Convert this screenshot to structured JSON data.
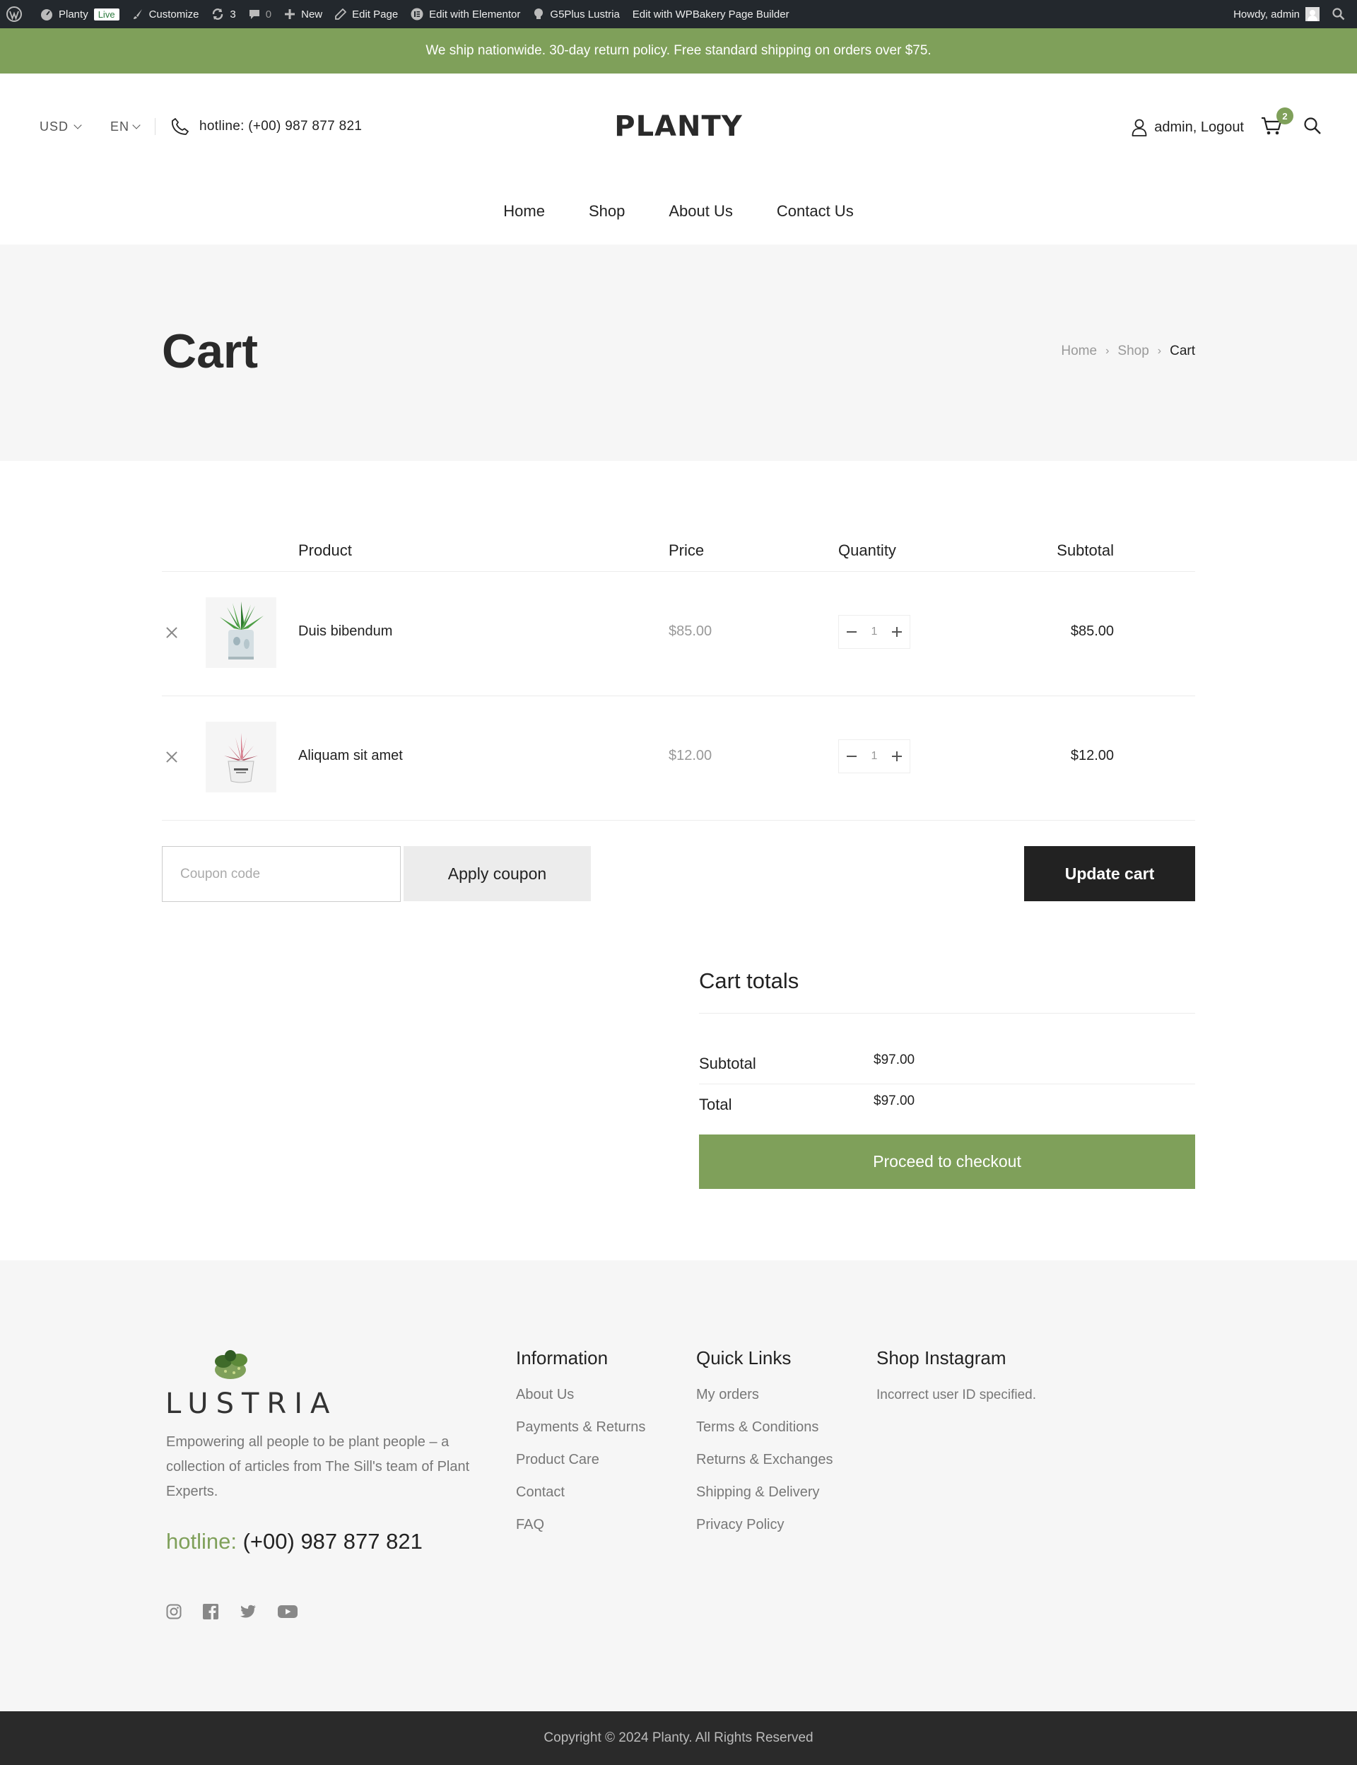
{
  "admin_bar": {
    "site_name": "Planty",
    "live_badge": "Live",
    "customize": "Customize",
    "updates_count": "3",
    "comments_count": "0",
    "new": "New",
    "edit_page": "Edit Page",
    "edit_elementor": "Edit with Elementor",
    "g5plus": "G5Plus Lustria",
    "edit_wpbakery": "Edit with WPBakery Page Builder",
    "howdy": "Howdy, admin"
  },
  "notice": "We ship nationwide. 30-day return policy. Free standard shipping on orders over $75.",
  "header": {
    "currency": "USD",
    "language": "EN",
    "hotline": "hotline: (+00) 987 877 821",
    "logo": "PLANTY",
    "account": "admin, Logout",
    "cart_count": "2"
  },
  "nav": [
    "Home",
    "Shop",
    "About Us",
    "Contact Us"
  ],
  "page_title": "Cart",
  "breadcrumb": [
    "Home",
    "Shop",
    "Cart"
  ],
  "cart": {
    "headers": {
      "product": "Product",
      "price": "Price",
      "quantity": "Quantity",
      "subtotal": "Subtotal"
    },
    "items": [
      {
        "name": "Duis bibendum",
        "price": "$85.00",
        "quantity": "1",
        "subtotal": "$85.00"
      },
      {
        "name": "Aliquam sit amet",
        "price": "$12.00",
        "quantity": "1",
        "subtotal": "$12.00"
      }
    ],
    "coupon_placeholder": "Coupon code",
    "apply_coupon": "Apply coupon",
    "update_cart": "Update cart"
  },
  "totals": {
    "title": "Cart totals",
    "subtotal_label": "Subtotal",
    "subtotal_value": "$97.00",
    "total_label": "Total",
    "total_value": "$97.00",
    "checkout": "Proceed to checkout"
  },
  "footer": {
    "logo": "LUSTRIA",
    "description": "Empowering all people to be plant people – a collection of articles from The Sill's team of Plant Experts.",
    "hotline_label": "hotline:",
    "hotline_number": "(+00) 987 877 821",
    "information": {
      "title": "Information",
      "links": [
        "About Us",
        "Payments & Returns",
        "Product Care",
        "Contact",
        "FAQ"
      ]
    },
    "quick_links": {
      "title": "Quick Links",
      "links": [
        "My orders",
        "Terms & Conditions",
        "Returns & Exchanges",
        "Shipping & Delivery",
        "Privacy Policy"
      ]
    },
    "instagram": {
      "title": "Shop Instagram",
      "message": "Incorrect user ID specified."
    },
    "social": [
      "instagram-icon",
      "facebook-icon",
      "twitter-icon",
      "youtube-icon"
    ]
  },
  "copyright": "Copyright © 2024 Planty. All Rights Reserved",
  "colors": {
    "accent": "#7fa05a",
    "admin_bar": "#23282d",
    "dark": "#222222",
    "footer_bg": "#f6f6f6"
  }
}
